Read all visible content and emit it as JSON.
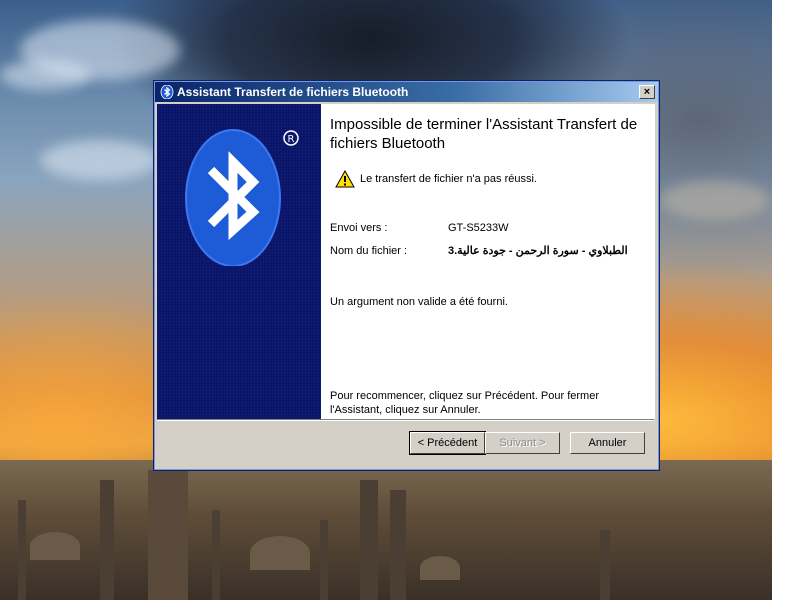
{
  "window": {
    "title": "Assistant Transfert de fichiers Bluetooth",
    "close_label": "×"
  },
  "content": {
    "heading": "Impossible de terminer l'Assistant Transfert de fichiers Bluetooth",
    "warning_text": "Le transfert de fichier n'a pas réussi.",
    "send_to_label": "Envoi vers :",
    "send_to_value": "GT-S5233W",
    "filename_label": "Nom du fichier :",
    "filename_value": "الطبلاوي - سورة الرحمن - جودة عالية.3",
    "error_message": "Un argument non valide a été fourni.",
    "instructions": "Pour recommencer, cliquez sur Précédent. Pour fermer l'Assistant, cliquez sur Annuler."
  },
  "buttons": {
    "previous_label": "< Précédent",
    "next_label": "Suivant >",
    "cancel_label": "Annuler"
  },
  "icons": {
    "title_icon": "bluetooth-icon",
    "logo": "bluetooth-logo",
    "warning": "warning-icon"
  },
  "colors": {
    "titlebar_start": "#0a246a",
    "titlebar_end": "#a6caf0",
    "left_panel": "#0a1464",
    "bluetooth_blue": "#1e5bd6",
    "warning_yellow": "#ffe000"
  }
}
